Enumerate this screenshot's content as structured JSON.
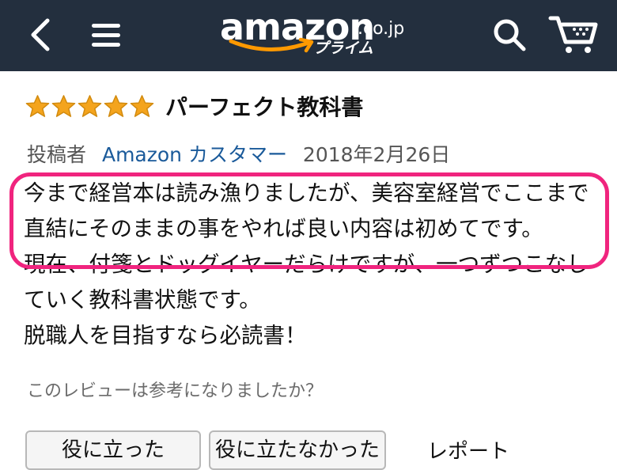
{
  "header": {
    "logo_word": "amazon",
    "logo_tld": ".co.jp",
    "logo_sub": "プライム",
    "icons": [
      "back-icon",
      "menu-icon",
      "search-icon",
      "cart-icon"
    ]
  },
  "review": {
    "rating": 5,
    "rating_max": 5,
    "title": "パーフェクト教科書",
    "byline_prefix": "投稿者",
    "author": "Amazon カスタマー",
    "date": "2018年2月26日",
    "body_lines": [
      "今まで経営本は読み漁りましたが、美容室経営でここまで直結にそのままの事をやれば良い内容は初めてです。",
      "現在、付箋とドッグイヤーだらけですが、一つずつこなしていく教科書状態です。",
      "脱職人を目指すなら必読書！"
    ],
    "helpful_question": "このレビューは参考になりましたか？"
  },
  "actions": {
    "helpful_label": "役に立った",
    "unhelpful_label": "役に立たなかった",
    "report_label": "レポート"
  },
  "colors": {
    "header_bg": "#232f3e",
    "star": "#f4a41d",
    "link": "#1a5a9a",
    "highlight": "#f0247e",
    "smile": "#ff9900"
  }
}
